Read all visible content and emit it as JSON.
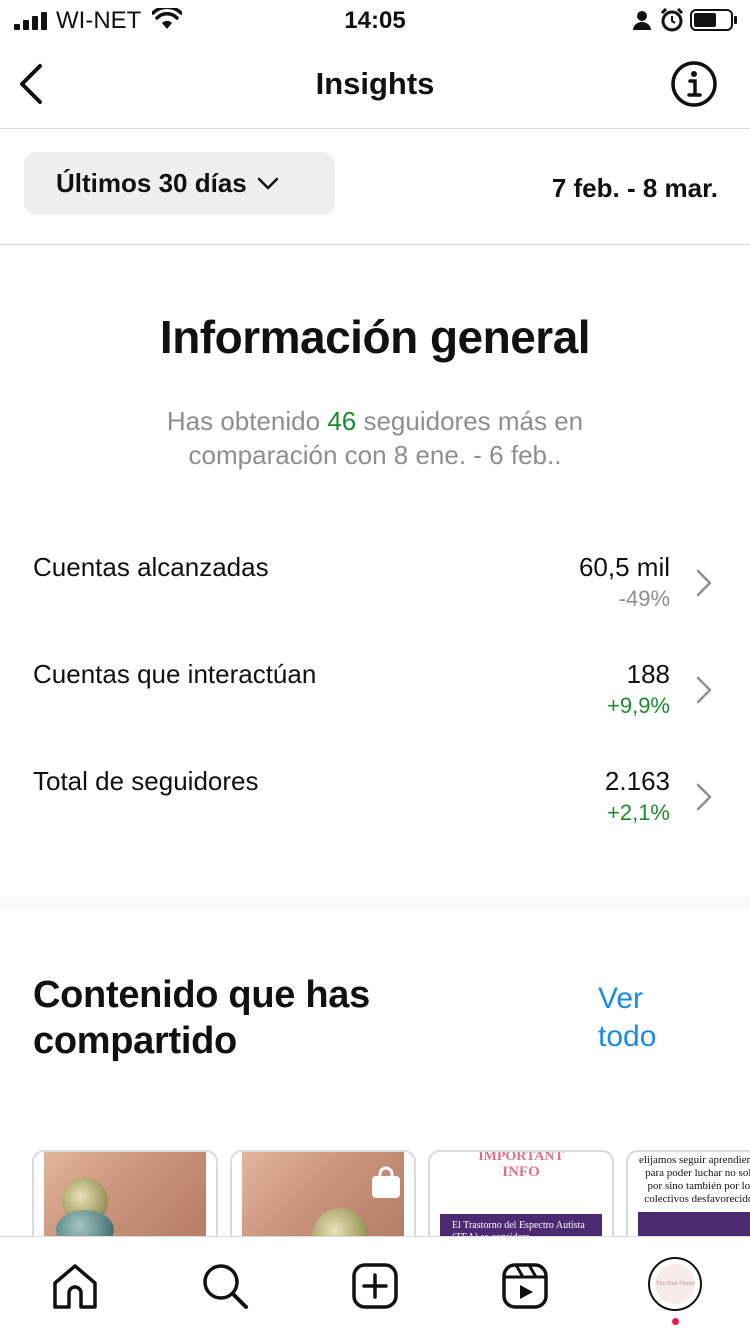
{
  "status_bar": {
    "carrier": "WI-NET",
    "time": "14:05"
  },
  "header": {
    "title": "Insights"
  },
  "filter": {
    "range_label": "Últimos 30 días",
    "date_range": "7 feb. - 8 mar."
  },
  "overview": {
    "title": "Información general",
    "subtitle_before": "Has obtenido ",
    "subtitle_count": "46",
    "subtitle_after": " seguidores más en comparación con 8 ene. - 6 feb.."
  },
  "metrics": [
    {
      "label": "Cuentas alcanzadas",
      "value": "60,5 mil",
      "change": "-49%"
    },
    {
      "label": "Cuentas que interactúan",
      "value": "188",
      "change": "+9,9%"
    },
    {
      "label": "Total de seguidores",
      "value": "2.163",
      "change": "+2,1%"
    }
  ],
  "content": {
    "title": "Contenido que has compartido",
    "see_all": "Ver todo",
    "posts": [
      {
        "title_1": "IMPORTANT",
        "title_2": "INFO",
        "text": "El Trastorno del Espectro Autista (TEA) se considera"
      },
      {
        "text": "elijamos seguir aprendiendo para poder luchar no solo por sino también por los colectivos desfavorecidos"
      }
    ]
  },
  "profile": {
    "avatar_text": "The Pink Planet"
  },
  "colors": {
    "accent_green": "#1e8a2e",
    "link_blue": "#1a8be6",
    "notification_red": "#ed1c4a"
  }
}
